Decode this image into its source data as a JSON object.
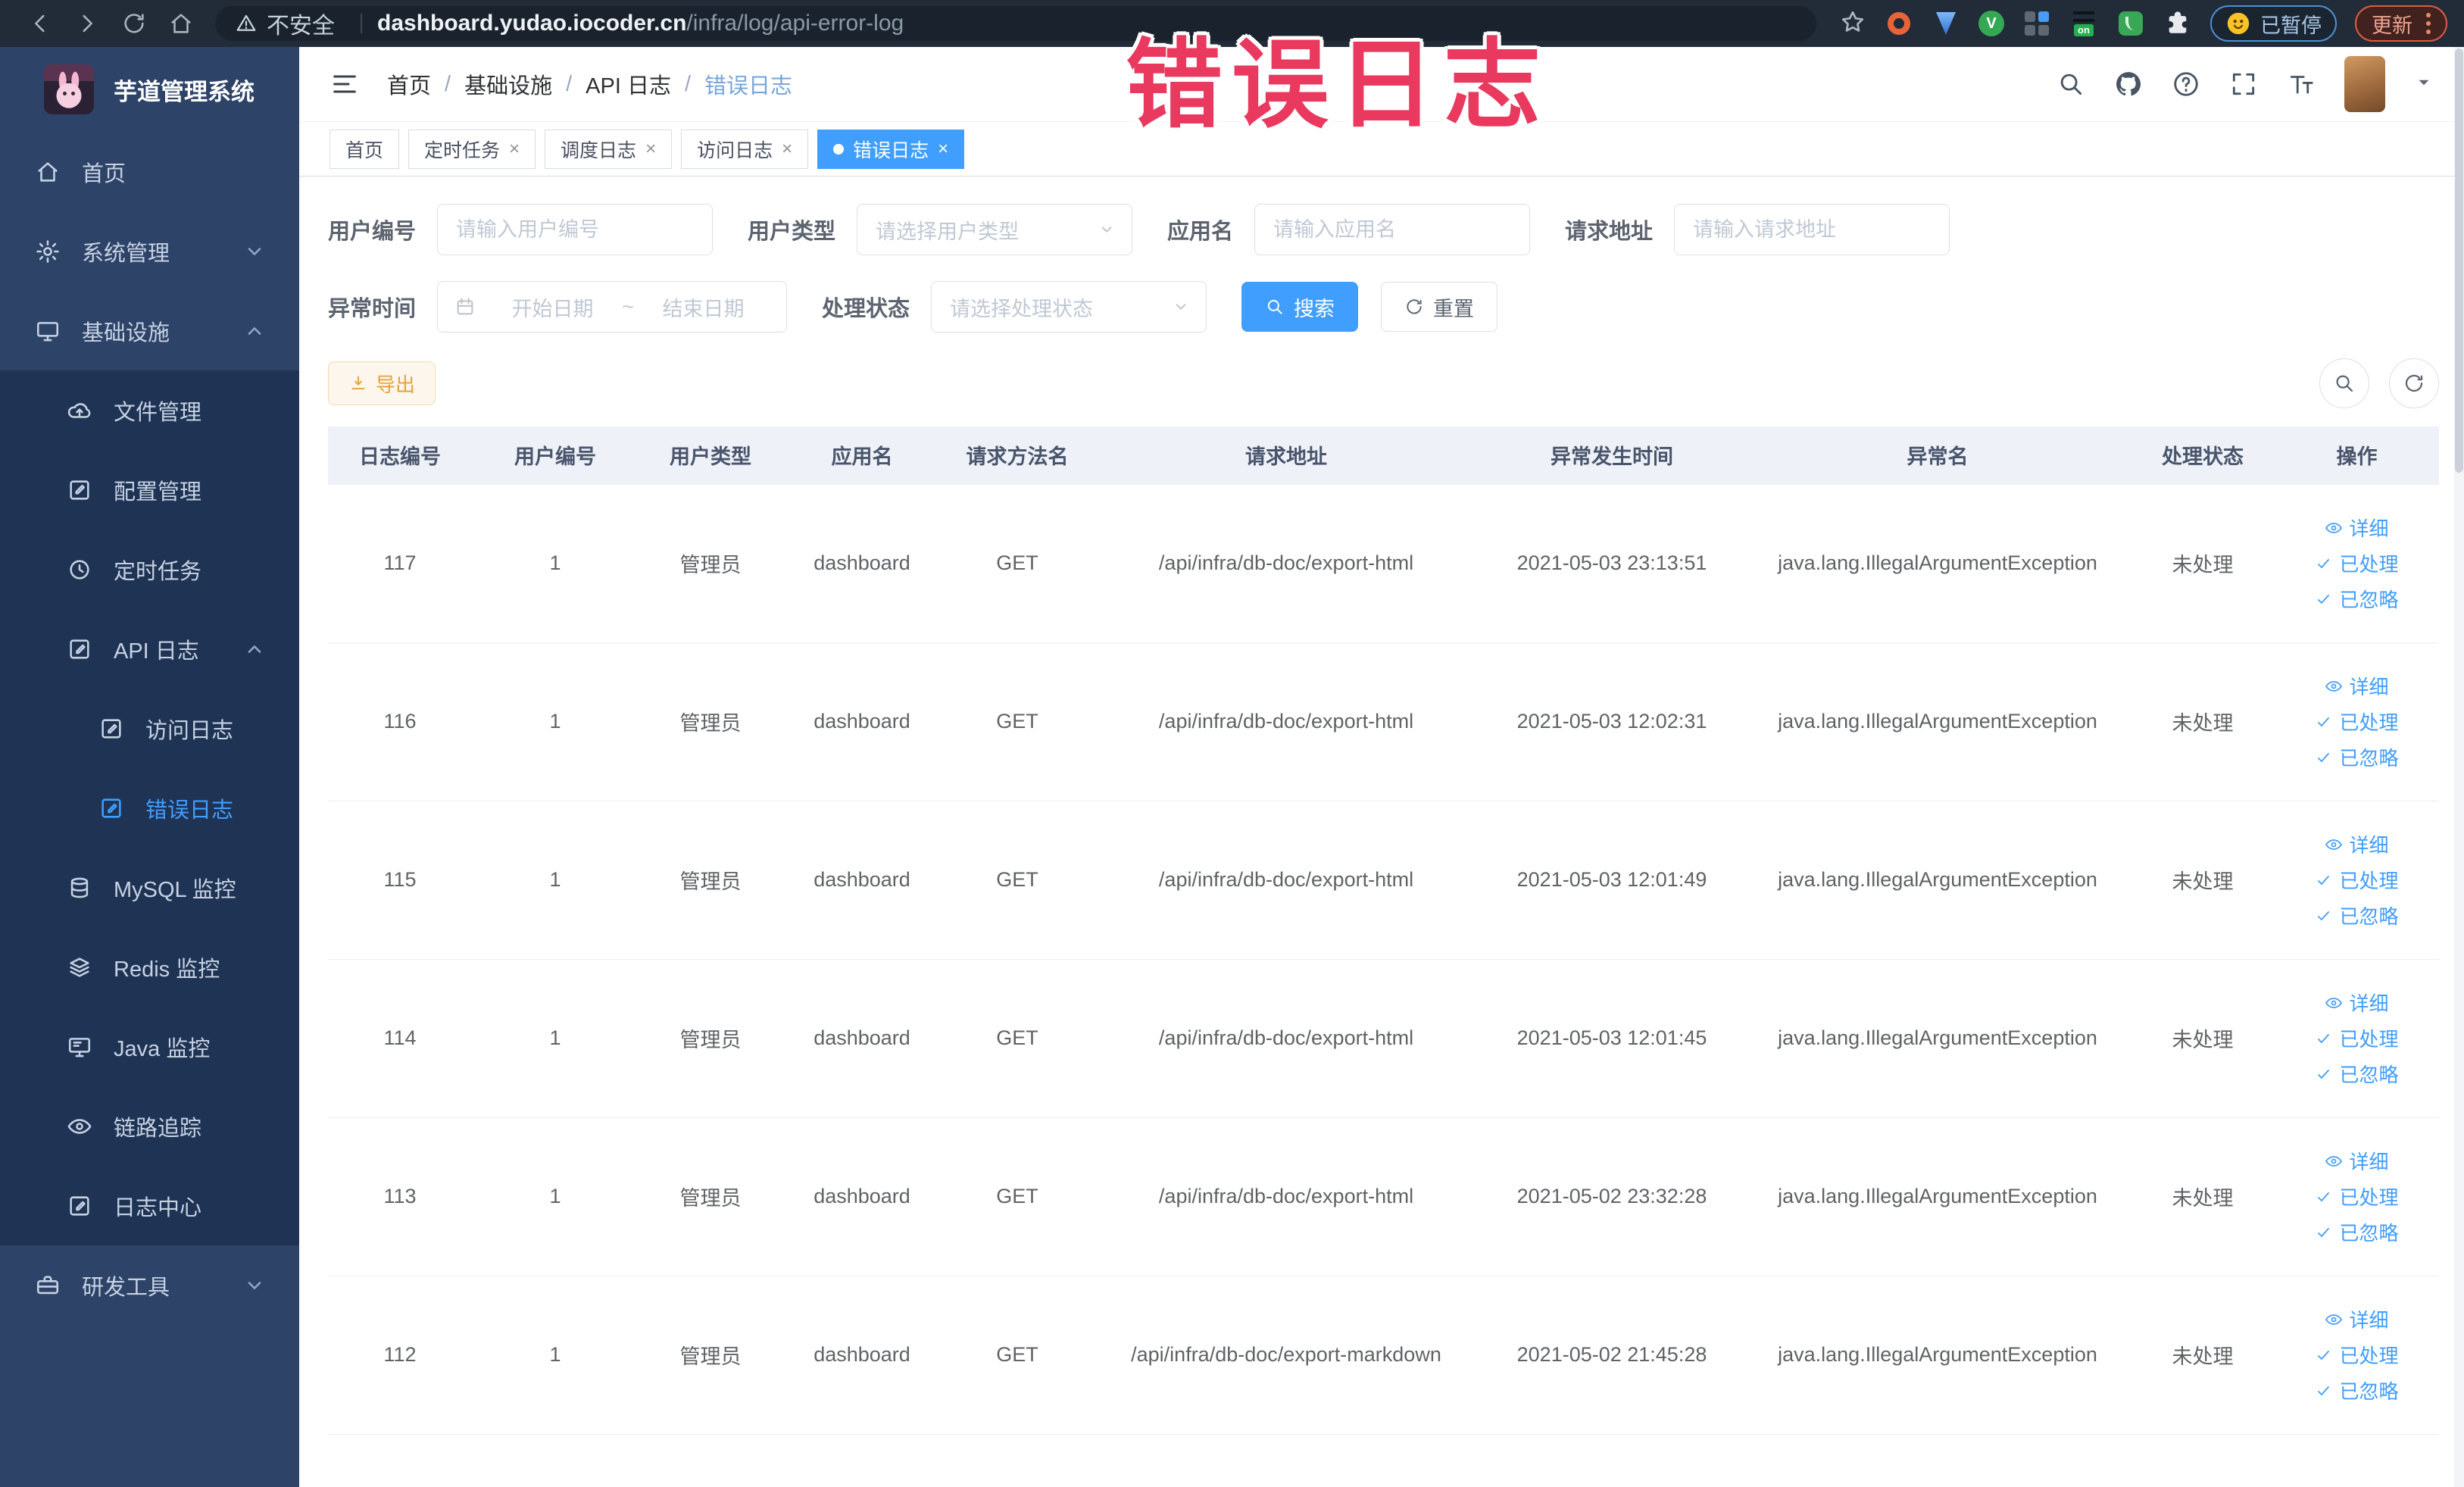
{
  "colors": {
    "accent": "#409eff",
    "overlay_red": "#e9395e",
    "warning": "#e6a23c",
    "sidebar_bg": "#2d4368",
    "sidebar_sub_bg": "#1f3354"
  },
  "browser": {
    "security_label": "不安全",
    "url_host": "dashboard.yudao.iocoder.cn",
    "url_path": "/infra/log/api-error-log",
    "paused_badge": "已暂停",
    "update_label": "更新"
  },
  "overlay_text": "错误日志",
  "sidebar": {
    "title": "芋道管理系统",
    "items": [
      {
        "label": "首页",
        "icon": "home-icon",
        "level": 0,
        "zone": "top",
        "chevron": null,
        "active": false
      },
      {
        "label": "系统管理",
        "icon": "gear-icon",
        "level": 0,
        "zone": "top",
        "chevron": "down",
        "active": false
      },
      {
        "label": "基础设施",
        "icon": "monitor-icon",
        "level": 0,
        "zone": "top",
        "chevron": "up",
        "active": false
      },
      {
        "label": "文件管理",
        "icon": "upload-icon",
        "level": 1,
        "zone": "sub",
        "chevron": null,
        "active": false
      },
      {
        "label": "配置管理",
        "icon": "edit-square-icon",
        "level": 1,
        "zone": "sub",
        "chevron": null,
        "active": false
      },
      {
        "label": "定时任务",
        "icon": "clock-icon",
        "level": 1,
        "zone": "sub",
        "chevron": null,
        "active": false
      },
      {
        "label": "API 日志",
        "icon": "log-icon",
        "level": 1,
        "zone": "sub",
        "chevron": "up",
        "active": false
      },
      {
        "label": "访问日志",
        "icon": "log-icon",
        "level": 2,
        "zone": "sub",
        "chevron": null,
        "active": false
      },
      {
        "label": "错误日志",
        "icon": "log-icon",
        "level": 2,
        "zone": "sub",
        "chevron": null,
        "active": true
      },
      {
        "label": "MySQL 监控",
        "icon": "mysql-icon",
        "level": 1,
        "zone": "sub",
        "chevron": null,
        "active": false
      },
      {
        "label": "Redis 监控",
        "icon": "redis-icon",
        "level": 1,
        "zone": "sub",
        "chevron": null,
        "active": false
      },
      {
        "label": "Java 监控",
        "icon": "java-icon",
        "level": 1,
        "zone": "sub",
        "chevron": null,
        "active": false
      },
      {
        "label": "链路追踪",
        "icon": "eye-icon",
        "level": 1,
        "zone": "sub",
        "chevron": null,
        "active": false
      },
      {
        "label": "日志中心",
        "icon": "log-icon",
        "level": 1,
        "zone": "sub",
        "chevron": null,
        "active": false
      },
      {
        "label": "研发工具",
        "icon": "tools-icon",
        "level": 0,
        "zone": "bottom",
        "chevron": "down",
        "active": false
      }
    ]
  },
  "header": {
    "breadcrumb": [
      "首页",
      "基础设施",
      "API 日志",
      "错误日志"
    ]
  },
  "tabs": [
    {
      "label": "首页",
      "closable": false,
      "active": false
    },
    {
      "label": "定时任务",
      "closable": true,
      "active": false
    },
    {
      "label": "调度日志",
      "closable": true,
      "active": false
    },
    {
      "label": "访问日志",
      "closable": true,
      "active": false
    },
    {
      "label": "错误日志",
      "closable": true,
      "active": true
    }
  ],
  "filters": {
    "user_id": {
      "label": "用户编号",
      "placeholder": "请输入用户编号"
    },
    "user_type": {
      "label": "用户类型",
      "placeholder": "请选择用户类型"
    },
    "app_name": {
      "label": "应用名",
      "placeholder": "请输入应用名"
    },
    "request_url": {
      "label": "请求地址",
      "placeholder": "请输入请求地址"
    },
    "exception_time": {
      "label": "异常时间",
      "start_placeholder": "开始日期",
      "separator": "~",
      "end_placeholder": "结束日期"
    },
    "process_status": {
      "label": "处理状态",
      "placeholder": "请选择处理状态"
    },
    "search_label": "搜索",
    "reset_label": "重置"
  },
  "toolbar": {
    "export_label": "导出"
  },
  "table": {
    "columns": [
      "日志编号",
      "用户编号",
      "用户类型",
      "应用名",
      "请求方法名",
      "请求地址",
      "异常发生时间",
      "异常名",
      "处理状态",
      "操作"
    ],
    "actions": [
      "详细",
      "已处理",
      "已忽略"
    ],
    "rows": [
      {
        "id": "117",
        "user_id": "1",
        "user_type": "管理员",
        "app": "dashboard",
        "method": "GET",
        "url": "/api/infra/db-doc/export-html",
        "time": "2021-05-03 23:13:51",
        "exception": "java.lang.IllegalArgumentException",
        "status": "未处理"
      },
      {
        "id": "116",
        "user_id": "1",
        "user_type": "管理员",
        "app": "dashboard",
        "method": "GET",
        "url": "/api/infra/db-doc/export-html",
        "time": "2021-05-03 12:02:31",
        "exception": "java.lang.IllegalArgumentException",
        "status": "未处理"
      },
      {
        "id": "115",
        "user_id": "1",
        "user_type": "管理员",
        "app": "dashboard",
        "method": "GET",
        "url": "/api/infra/db-doc/export-html",
        "time": "2021-05-03 12:01:49",
        "exception": "java.lang.IllegalArgumentException",
        "status": "未处理"
      },
      {
        "id": "114",
        "user_id": "1",
        "user_type": "管理员",
        "app": "dashboard",
        "method": "GET",
        "url": "/api/infra/db-doc/export-html",
        "time": "2021-05-03 12:01:45",
        "exception": "java.lang.IllegalArgumentException",
        "status": "未处理"
      },
      {
        "id": "113",
        "user_id": "1",
        "user_type": "管理员",
        "app": "dashboard",
        "method": "GET",
        "url": "/api/infra/db-doc/export-html",
        "time": "2021-05-02 23:32:28",
        "exception": "java.lang.IllegalArgumentException",
        "status": "未处理"
      },
      {
        "id": "112",
        "user_id": "1",
        "user_type": "管理员",
        "app": "dashboard",
        "method": "GET",
        "url": "/api/infra/db-doc/export-markdown",
        "time": "2021-05-02 21:45:28",
        "exception": "java.lang.IllegalArgumentException",
        "status": "未处理"
      }
    ]
  }
}
